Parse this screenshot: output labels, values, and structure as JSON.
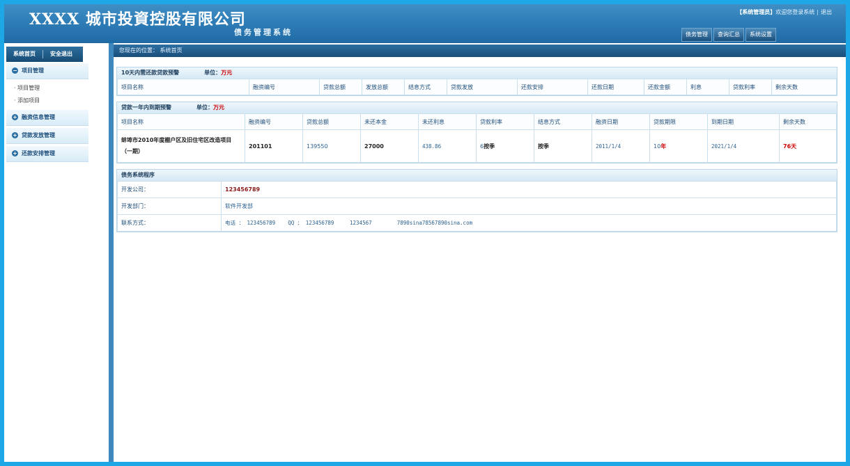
{
  "header": {
    "title": "XXXX 城市投資控股有限公司",
    "subtitle": "债务管理系统",
    "role": "【系统管理员】",
    "welcome": "欢迎您登录系统",
    "logout": "退出",
    "nav": [
      "债务管理",
      "查询汇总",
      "系统设置"
    ]
  },
  "sidebar": {
    "top_links": [
      "系统首页",
      "安全退出"
    ],
    "groups": [
      {
        "label": "项目管理",
        "icon": "minus-circle-icon",
        "items": [
          "项目管理",
          "添加项目"
        ]
      },
      {
        "label": "融资信息管理",
        "icon": "plus-circle-icon"
      },
      {
        "label": "贷款发放管理",
        "icon": "plus-circle-icon"
      },
      {
        "label": "还款安排管理",
        "icon": "plus-circle-icon"
      }
    ]
  },
  "breadcrumb": "您现在的位置： 系统首页",
  "panel1": {
    "title": "10天内需还款贷款预警",
    "unit_label": "单位：",
    "unit": "万元",
    "columns": [
      "项目名称",
      "融资编号",
      "贷款总额",
      "发放总额",
      "结息方式",
      "贷款发放",
      "还款安排",
      "还款日期",
      "还款金额",
      "利息",
      "贷款利率",
      "剩余天数"
    ]
  },
  "panel2": {
    "title": "贷款一年内到期预警",
    "unit_label": "单位：",
    "unit": "万元",
    "columns": [
      "项目名称",
      "融资编号",
      "贷款总额",
      "未还本金",
      "未还利息",
      "贷款利率",
      "结息方式",
      "融资日期",
      "贷款期限",
      "到期日期",
      "剩余天数"
    ],
    "row": {
      "name": "蚌埠市2010年度棚户区及旧住宅区改造项目（一期）",
      "code": "201101",
      "total": "139550",
      "principal": "27000",
      "interest": "438.86",
      "rate_num": "6",
      "rate_text": "按季",
      "method": "按季",
      "date": "2011/1/4",
      "term_num": "10",
      "term_unit": "年",
      "due": "2021/1/4",
      "remain": "76天"
    }
  },
  "panel3": {
    "title": "债务系统程序",
    "rows": [
      {
        "label": "开发公司：",
        "value": "123456789"
      },
      {
        "label": "开发部门：",
        "value": "软件开发部"
      },
      {
        "label": "联系方式：",
        "value": "电话 ： 123456789    QQ ： 123456789     1234567        7890sina78567890sina.com"
      }
    ]
  },
  "colors": {
    "frame": "#1ea7e6",
    "header": "#2f7db7",
    "accent_red": "#cc0000"
  }
}
